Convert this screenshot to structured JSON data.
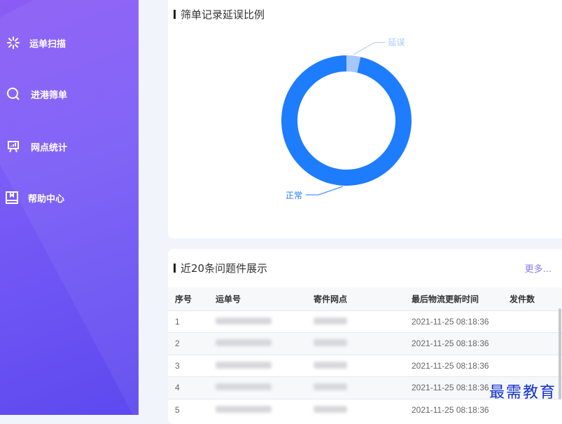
{
  "sidebar": {
    "items": [
      {
        "label": "运单扫描",
        "icon": "scan-icon"
      },
      {
        "label": "进港筛单",
        "icon": "search-icon"
      },
      {
        "label": "网点统计",
        "icon": "presentation-chart-icon"
      },
      {
        "label": "帮助中心",
        "icon": "book-icon"
      }
    ]
  },
  "donut": {
    "title": "筛单记录延误比例",
    "slices": [
      {
        "label": "延误",
        "value": 3.5,
        "color": "#a6c8ff"
      },
      {
        "label": "正常",
        "value": 96.5,
        "color": "#1e7cff"
      }
    ]
  },
  "table": {
    "title": "近20条问题件展示",
    "more": "更多...",
    "headers": [
      "序号",
      "运单号",
      "寄件网点",
      "最后物流更新时间",
      "发件数"
    ],
    "rows": [
      {
        "index": "1",
        "time": "2021-11-25 08:18:36"
      },
      {
        "index": "2",
        "time": "2021-11-25 08:18:36"
      },
      {
        "index": "3",
        "time": "2021-11-25 08:18:36"
      },
      {
        "index": "4",
        "time": "2021-11-25 08:18:36"
      },
      {
        "index": "5",
        "time": "2021-11-25 08:18:36"
      }
    ]
  },
  "watermark": "最需教育"
}
